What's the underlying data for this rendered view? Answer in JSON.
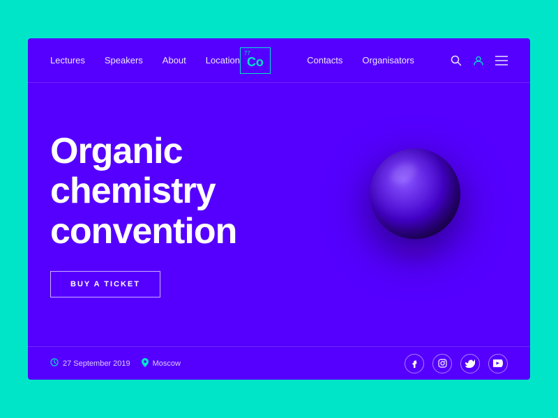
{
  "background_color": "#00e5c8",
  "card_color": "#5500ff",
  "navbar": {
    "left_items": [
      {
        "label": "Lectures",
        "id": "lectures"
      },
      {
        "label": "Speakers",
        "id": "speakers"
      },
      {
        "label": "About",
        "id": "about"
      },
      {
        "label": "Location",
        "id": "location"
      }
    ],
    "logo": {
      "superscript": "77",
      "text": "Co"
    },
    "right_items": [
      {
        "label": "Contacts",
        "id": "contacts"
      },
      {
        "label": "Organisators",
        "id": "organisators"
      }
    ],
    "icons": {
      "search": "🔍",
      "user": "👤",
      "menu": "☰"
    }
  },
  "hero": {
    "title": "Organic chemistry convention",
    "button_label": "BUY A TICKET"
  },
  "footer": {
    "date_icon": "🕐",
    "date": "27 September 2019",
    "location_icon": "📍",
    "location": "Moscow",
    "social": [
      {
        "icon": "f",
        "name": "facebook"
      },
      {
        "icon": "◎",
        "name": "instagram"
      },
      {
        "icon": "t",
        "name": "twitter"
      },
      {
        "icon": "▶",
        "name": "youtube"
      }
    ]
  }
}
